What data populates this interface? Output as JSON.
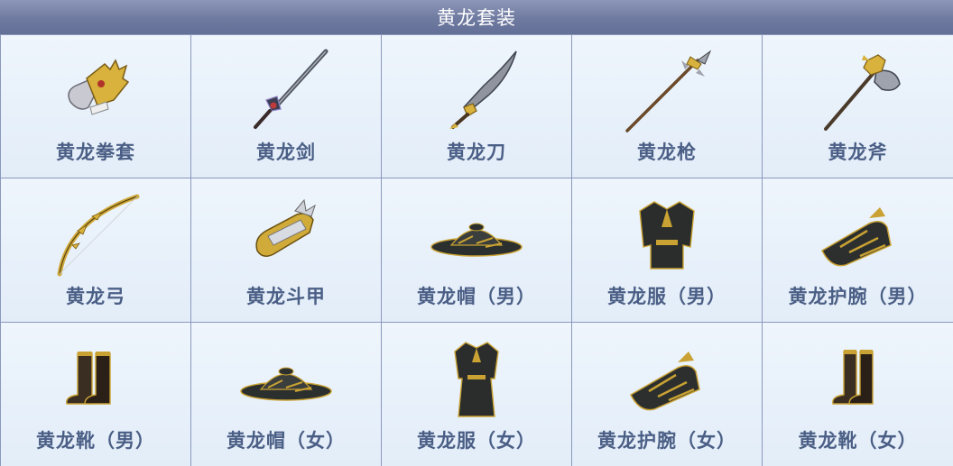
{
  "header": {
    "title": "黄龙套装"
  },
  "items": [
    {
      "label": "黄龙拳套",
      "icon": "gauntlet-icon"
    },
    {
      "label": "黄龙剑",
      "icon": "sword-icon"
    },
    {
      "label": "黄龙刀",
      "icon": "blade-icon"
    },
    {
      "label": "黄龙枪",
      "icon": "spear-icon"
    },
    {
      "label": "黄龙斧",
      "icon": "axe-icon"
    },
    {
      "label": "黄龙弓",
      "icon": "bow-icon"
    },
    {
      "label": "黄龙斗甲",
      "icon": "arm-guard-icon"
    },
    {
      "label": "黄龙帽（男）",
      "icon": "hat-icon"
    },
    {
      "label": "黄龙服（男）",
      "icon": "robe-icon"
    },
    {
      "label": "黄龙护腕（男）",
      "icon": "bracer-icon"
    },
    {
      "label": "黄龙靴（男）",
      "icon": "boots-icon"
    },
    {
      "label": "黄龙帽（女）",
      "icon": "hat-icon"
    },
    {
      "label": "黄龙服（女）",
      "icon": "robe-icon"
    },
    {
      "label": "黄龙护腕（女）",
      "icon": "bracer-icon"
    },
    {
      "label": "黄龙靴（女）",
      "icon": "boots-icon"
    }
  ],
  "colors": {
    "header": "#6f7aa0",
    "label": "#4b5f86",
    "gold": "#c9a233",
    "dark": "#2a2a2a",
    "cell_bg": "#e9f1fa",
    "border": "#8a98bd"
  }
}
